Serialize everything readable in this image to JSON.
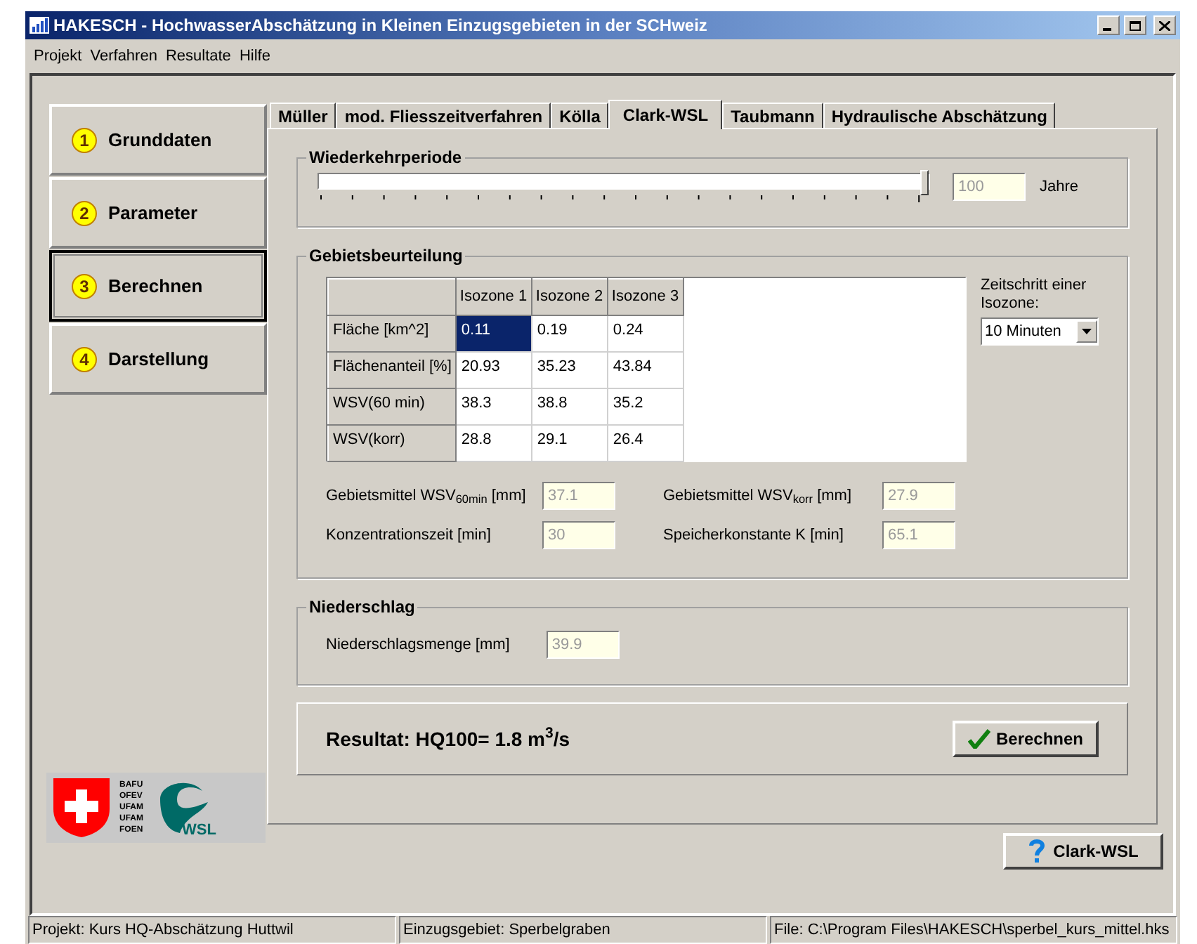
{
  "window": {
    "title": "HAKESCH - HochwasserAbschätzung in Kleinen Einzugsgebieten in der SCHweiz"
  },
  "menu": [
    "Projekt",
    "Verfahren",
    "Resultate",
    "Hilfe"
  ],
  "steps": [
    {
      "number": "1",
      "label": "Grunddaten",
      "selected": false
    },
    {
      "number": "2",
      "label": "Parameter",
      "selected": false
    },
    {
      "number": "3",
      "label": "Berechnen",
      "selected": true
    },
    {
      "number": "4",
      "label": "Darstellung",
      "selected": false
    }
  ],
  "tabs": [
    {
      "label": "Müller",
      "selected": false
    },
    {
      "label": "mod. Fliesszeitverfahren",
      "selected": false
    },
    {
      "label": "Kölla",
      "selected": false
    },
    {
      "label": "Clark-WSL",
      "selected": true
    },
    {
      "label": "Taubmann",
      "selected": false
    },
    {
      "label": "Hydraulische Abschätzung",
      "selected": false
    }
  ],
  "return_period": {
    "title": "Wiederkehrperiode",
    "level": 1,
    "value": "100",
    "unit": "Jahre"
  },
  "area": {
    "title": "Gebietsbeurteilung",
    "columns": [
      "Isozone 1",
      "Isozone 2",
      "Isozone 3"
    ],
    "rows": [
      {
        "label": "Fläche [km^2]",
        "cells": [
          {
            "value": "0.11",
            "selected": true
          },
          {
            "value": "0.19",
            "selected": false
          },
          {
            "value": "0.24",
            "selected": false
          }
        ]
      },
      {
        "label": "Flächenanteil [%]",
        "cells": [
          {
            "value": "20.93",
            "selected": false
          },
          {
            "value": "35.23",
            "selected": false
          },
          {
            "value": "43.84",
            "selected": false
          }
        ]
      },
      {
        "label": "WSV(60 min)",
        "cells": [
          {
            "value": "38.3",
            "selected": false
          },
          {
            "value": "38.8",
            "selected": false
          },
          {
            "value": "35.2",
            "selected": false
          }
        ]
      },
      {
        "label": "WSV(korr)",
        "cells": [
          {
            "value": "28.8",
            "selected": false
          },
          {
            "value": "29.1",
            "selected": false
          },
          {
            "value": "26.4",
            "selected": false
          }
        ]
      }
    ],
    "timestep_label": "Zeitschritt einer Isozone:",
    "timestep": "10 Minuten",
    "fields": [
      {
        "label": "Gebietsmittel WSV$_{60min}$ [mm]",
        "value": "37.1"
      },
      {
        "label": "Gebietsmittel WSV$_{korr}$ [mm]",
        "value": "27.9"
      },
      {
        "label": "Konzentrationszeit [min]",
        "value": "30"
      },
      {
        "label": "Speicherkonstante K [min]",
        "value": "65.1"
      }
    ]
  },
  "precipitation": {
    "title": "Niederschlag",
    "label": "Niederschlagsmenge [mm]",
    "value": "39.9"
  },
  "result": {
    "text": "Resultat: HQ100= 1.8 m$^{3}$/s",
    "button": "Berechnen"
  },
  "help_button": "Clark-WSL",
  "logo": {
    "lines": [
      "BAFU",
      "OFEV",
      "UFAM",
      "UFAM",
      "FOEN"
    ],
    "wsl": "WSL"
  },
  "status_bar": [
    "Projekt: Kurs HQ-Abschätzung Huttwil",
    "Einzugsgebiet: Sperbelgraben",
    "File: C:\\Program Files\\HAKESCH\\sperbel_kurs_mittel.hks"
  ]
}
